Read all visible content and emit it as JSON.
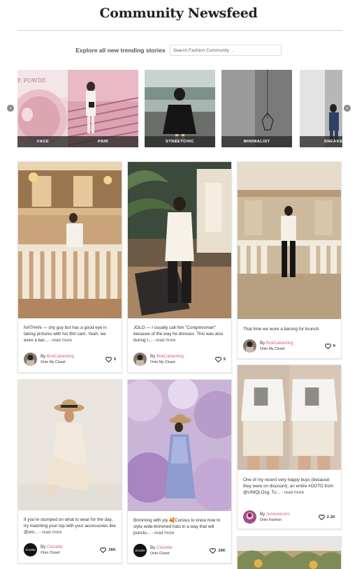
{
  "page": {
    "title": "Community Newsfeed"
  },
  "search": {
    "label": "Explore all new trending stories",
    "placeholder": "Search Fashion Community ..."
  },
  "categories": [
    {
      "label": "FACE"
    },
    {
      "label": "PAIR"
    },
    {
      "label": "STREETCHIC"
    },
    {
      "label": "MINIMALIST"
    },
    {
      "label": "SNEAKER"
    }
  ],
  "carousel": {
    "prev_icon": "chevron-left-icon",
    "next_icon": "chevron-right-icon"
  },
  "posts": [
    {
      "caption": "NATHAN — shy guy but has a good eye in taking pictures with his film cam. Yeah, we wore a bar...",
      "read_more": "- read more",
      "by": "By",
      "user": "BokCabanting",
      "onto": "Onto My Closet",
      "likes": "9"
    },
    {
      "caption": "JOLO — I usually call him \"Congressman\" because of the way he dresses. This was also during t...",
      "read_more": "- read more",
      "by": "By",
      "user": "BokCabanting",
      "onto": "Onto My Closet",
      "likes": "9"
    },
    {
      "caption": "That time we wore a barong for brunch.",
      "read_more": "",
      "by": "By",
      "user": "BokCabanting",
      "onto": "Onto My Closet",
      "likes": "9"
    },
    {
      "caption": "If you're stumped on what to wear for the day, try matching your top with your accessories like @om...",
      "read_more": "- read more",
      "by": "By",
      "user": "Clozette",
      "onto": "Onto Closet",
      "likes": "26K"
    },
    {
      "caption": "Brimming with joy 🥰Curious to know how to style wide-brimmed hats in a way that will punctu...",
      "read_more": "- read more",
      "by": "By",
      "user": "Clozette",
      "onto": "Onto Closet",
      "likes": "26K"
    },
    {
      "caption": "One of my recent very happy buys (because they were on discount), an entire #OOTD from @UNIQLOsg. Tu...",
      "read_more": "- read more",
      "by": "By",
      "user": "Juneunicorn",
      "onto": "Onto Fashion",
      "likes": "2.1K"
    }
  ],
  "avatars": {
    "clozette_text": "clozette"
  },
  "colors": {
    "username": "#d35d8a",
    "label_bar": "#333333"
  }
}
